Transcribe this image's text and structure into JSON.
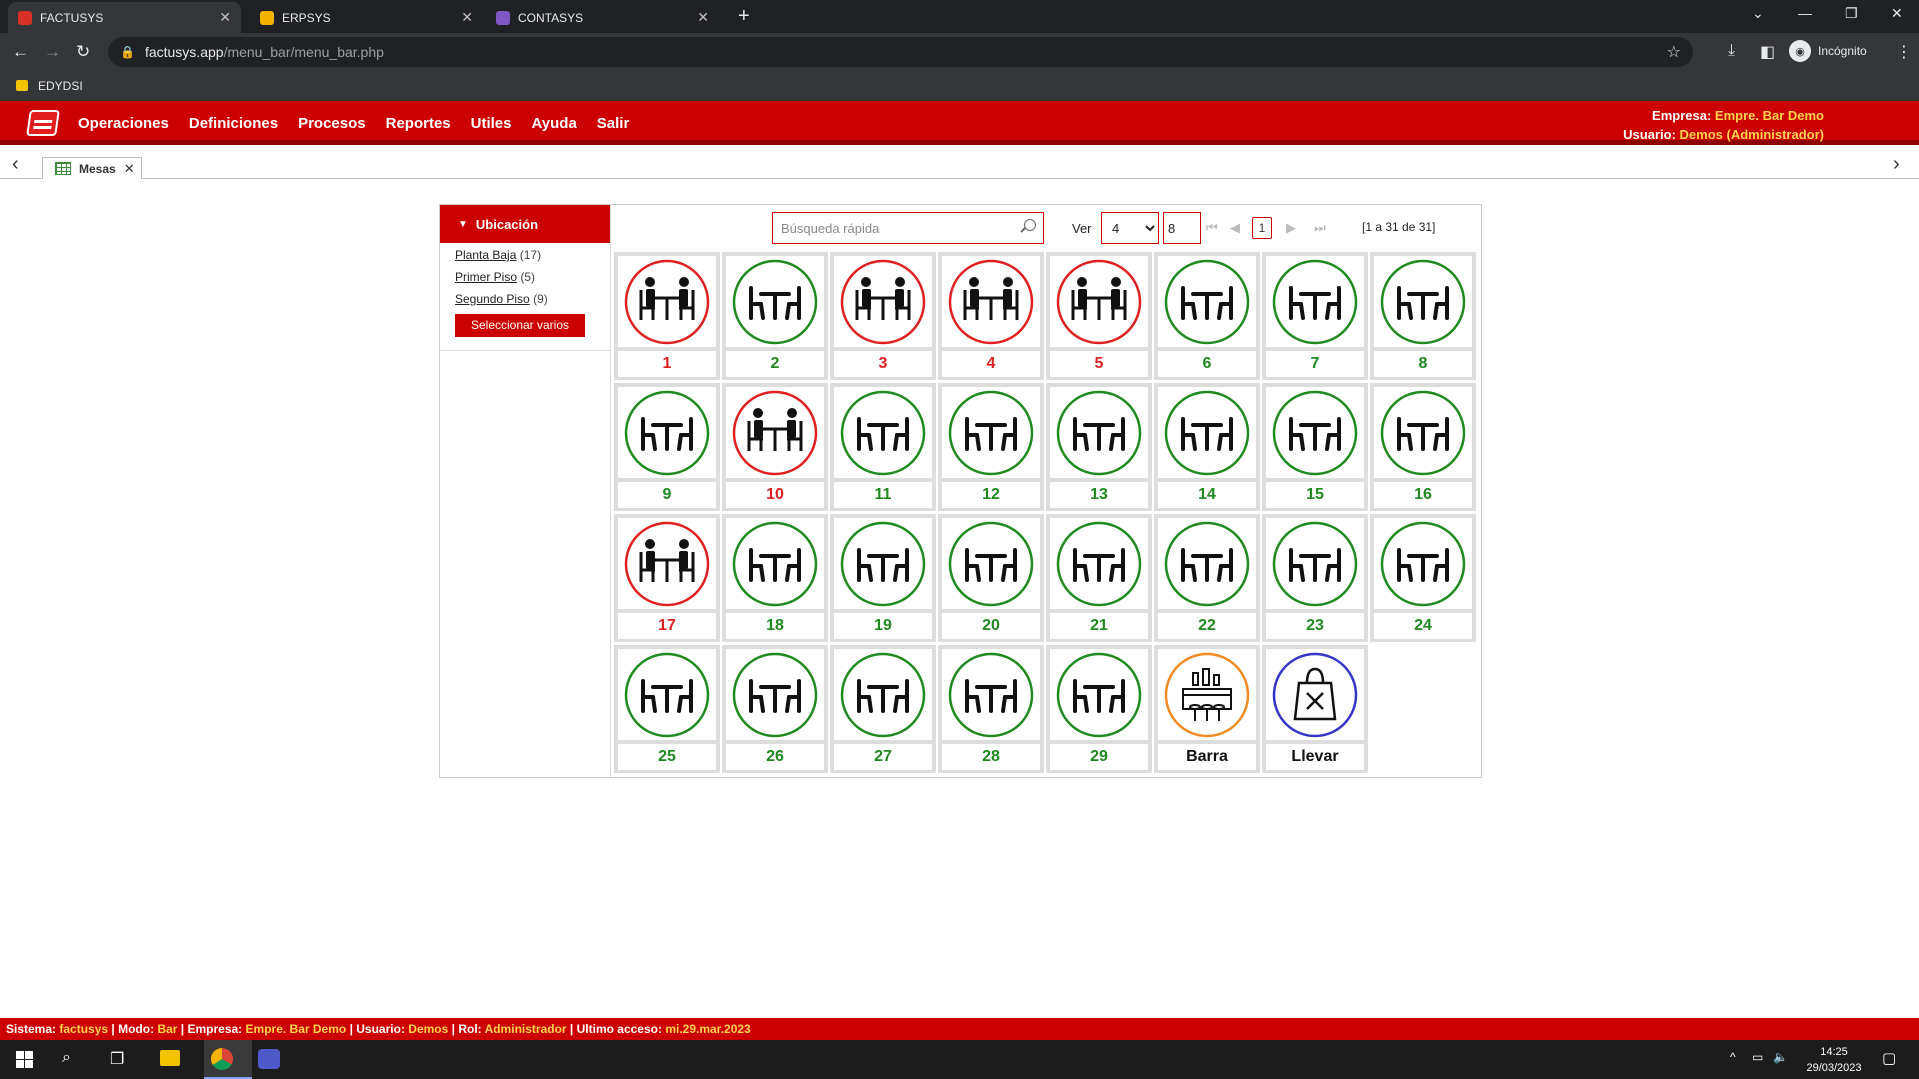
{
  "browser": {
    "tabs": [
      {
        "label": "FACTUSYS",
        "active": true,
        "color": "#d93025"
      },
      {
        "label": "ERPSYS",
        "active": false,
        "color": "#f2b300"
      },
      {
        "label": "CONTASYS",
        "active": false,
        "color": "#7e57c2"
      }
    ],
    "url_host": "factusys.app",
    "url_path": "/menu_bar/menu_bar.php",
    "profile": "Incógnito",
    "bookmark": "EDYDSI"
  },
  "app": {
    "menu": [
      "Operaciones",
      "Definiciones",
      "Procesos",
      "Reportes",
      "Utiles",
      "Ayuda",
      "Salir"
    ],
    "empresa_label": "Empresa:",
    "empresa_value": "Empre. Bar Demo",
    "usuario_label": "Usuario:",
    "usuario_value": "Demos (Administrador)",
    "tab_label": "Mesas"
  },
  "sidebar": {
    "title": "Ubicación",
    "locations": [
      {
        "name": "Planta Baja",
        "count": "(17)"
      },
      {
        "name": "Primer Piso",
        "count": "(5)"
      },
      {
        "name": "Segundo Piso",
        "count": "(9)"
      }
    ],
    "select_button": "Seleccionar varios"
  },
  "filters": {
    "search_placeholder": "Búsqueda rápida",
    "ver_label": "Ver",
    "ver_value": "4",
    "ver_input": "8",
    "page": "1",
    "range": "[1 a 31 de 31]"
  },
  "colors": {
    "occupied": "#e02020",
    "free": "#1f8a1f",
    "bar": "#f08a24",
    "takeaway": "#3535c8",
    "brand": "#cc0000"
  },
  "tables": [
    {
      "label": "1",
      "status": "occupied"
    },
    {
      "label": "2",
      "status": "free"
    },
    {
      "label": "3",
      "status": "occupied"
    },
    {
      "label": "4",
      "status": "occupied"
    },
    {
      "label": "5",
      "status": "occupied"
    },
    {
      "label": "6",
      "status": "free"
    },
    {
      "label": "7",
      "status": "free"
    },
    {
      "label": "8",
      "status": "free"
    },
    {
      "label": "9",
      "status": "free"
    },
    {
      "label": "10",
      "status": "occupied"
    },
    {
      "label": "11",
      "status": "free"
    },
    {
      "label": "12",
      "status": "free"
    },
    {
      "label": "13",
      "status": "free"
    },
    {
      "label": "14",
      "status": "free"
    },
    {
      "label": "15",
      "status": "free"
    },
    {
      "label": "16",
      "status": "free"
    },
    {
      "label": "17",
      "status": "occupied"
    },
    {
      "label": "18",
      "status": "free"
    },
    {
      "label": "19",
      "status": "free"
    },
    {
      "label": "20",
      "status": "free"
    },
    {
      "label": "21",
      "status": "free"
    },
    {
      "label": "22",
      "status": "free"
    },
    {
      "label": "23",
      "status": "free"
    },
    {
      "label": "24",
      "status": "free"
    },
    {
      "label": "25",
      "status": "free"
    },
    {
      "label": "26",
      "status": "free"
    },
    {
      "label": "27",
      "status": "free"
    },
    {
      "label": "28",
      "status": "free"
    },
    {
      "label": "29",
      "status": "free"
    },
    {
      "label": "Barra",
      "status": "bar"
    },
    {
      "label": "Llevar",
      "status": "takeaway"
    }
  ],
  "statusbar": {
    "items": [
      {
        "label": "Sistema:",
        "value": "factusys"
      },
      {
        "label": "Modo:",
        "value": "Bar"
      },
      {
        "label": "Empresa:",
        "value": "Empre. Bar Demo"
      },
      {
        "label": "Usuario:",
        "value": "Demos"
      },
      {
        "label": "Rol:",
        "value": "Administrador"
      },
      {
        "label": "Ultimo acceso:",
        "value": "mi.29.mar.2023"
      }
    ]
  },
  "taskbar": {
    "time": "14:25",
    "date": "29/03/2023"
  }
}
